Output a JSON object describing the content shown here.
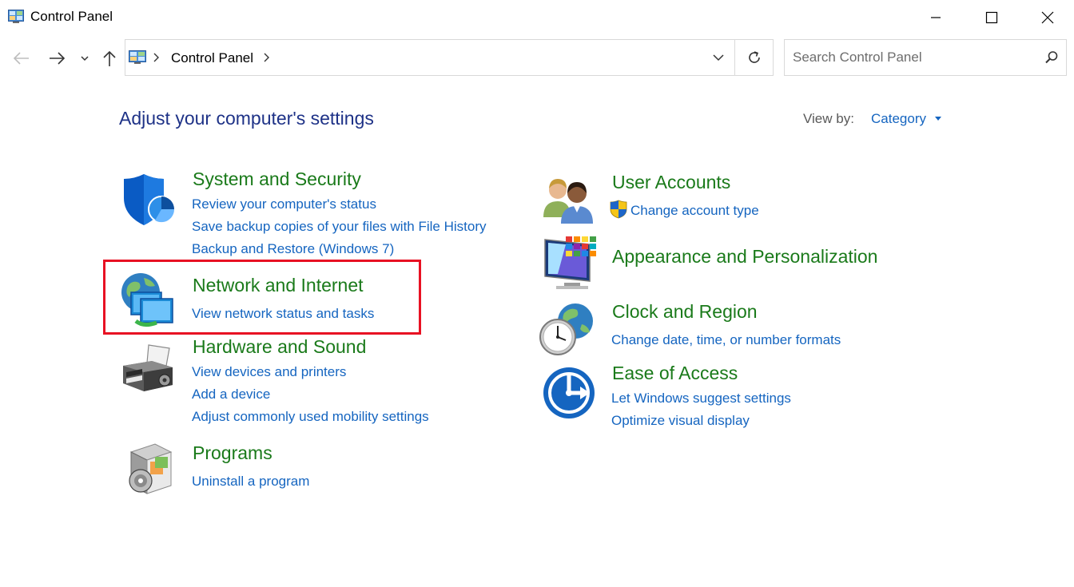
{
  "window": {
    "title": "Control Panel"
  },
  "address": {
    "path_label": "Control Panel",
    "separator": "›"
  },
  "search": {
    "placeholder": "Search Control Panel",
    "value": ""
  },
  "header": {
    "title": "Adjust your computer's settings",
    "view_by_label": "View by:",
    "view_by_value": "Category"
  },
  "categories": {
    "system_security": {
      "icon": "shield-icon",
      "title": "System and Security",
      "links": [
        "Review your computer's status",
        "Save backup copies of your files with File History",
        "Backup and Restore (Windows 7)"
      ]
    },
    "network_internet": {
      "icon": "network-globe-icon",
      "title": "Network and Internet",
      "links": [
        "View network status and tasks"
      ]
    },
    "hardware_sound": {
      "icon": "printer-icon",
      "title": "Hardware and Sound",
      "links": [
        "View devices and printers",
        "Add a device",
        "Adjust commonly used mobility settings"
      ]
    },
    "programs": {
      "icon": "programs-disc-icon",
      "title": "Programs",
      "links": [
        "Uninstall a program"
      ]
    },
    "user_accounts": {
      "icon": "users-icon",
      "title": "User Accounts",
      "links": [
        "Change account type"
      ]
    },
    "appearance": {
      "icon": "monitor-palette-icon",
      "title": "Appearance and Personalization",
      "links": []
    },
    "clock_region": {
      "icon": "clock-globe-icon",
      "title": "Clock and Region",
      "links": [
        "Change date, time, or number formats"
      ]
    },
    "ease_access": {
      "icon": "ease-of-access-icon",
      "title": "Ease of Access",
      "links": [
        "Let Windows suggest settings",
        "Optimize visual display"
      ]
    }
  },
  "colors": {
    "heading": "#1e3287",
    "category_title": "#1a7a1a",
    "link": "#1565c0",
    "highlight": "#e81123"
  }
}
